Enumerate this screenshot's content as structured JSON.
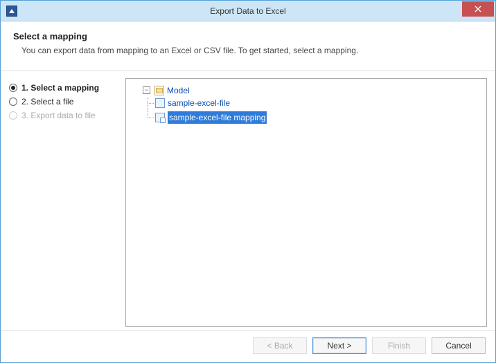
{
  "window": {
    "title": "Export Data to Excel"
  },
  "header": {
    "title": "Select a mapping",
    "subtitle": "You can export data from mapping to an Excel or CSV file. To get started, select a mapping."
  },
  "steps": [
    {
      "label": "1. Select a mapping",
      "selected": true,
      "enabled": true
    },
    {
      "label": "2. Select a file",
      "selected": false,
      "enabled": true
    },
    {
      "label": "3. Export data to file",
      "selected": false,
      "enabled": false
    }
  ],
  "tree": {
    "root": {
      "label": "Model",
      "toggler": "−",
      "children": [
        {
          "label": "sample-excel-file",
          "type": "file",
          "selected": false
        },
        {
          "label": "sample-excel-file mapping",
          "type": "mapping",
          "selected": true
        }
      ]
    }
  },
  "buttons": {
    "back": "< Back",
    "next": "Next >",
    "finish": "Finish",
    "cancel": "Cancel"
  }
}
